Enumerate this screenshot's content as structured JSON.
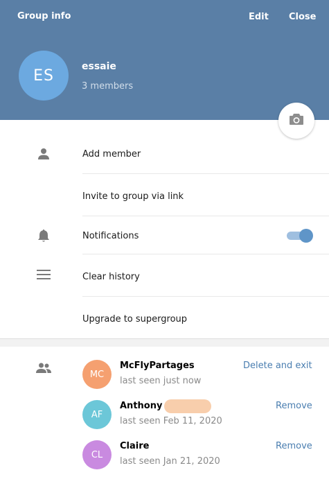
{
  "header": {
    "title": "Group info",
    "edit_label": "Edit",
    "close_label": "Close",
    "background": "#5a7fa6"
  },
  "group": {
    "initials": "ES",
    "name": "essaie",
    "members": "3 members",
    "avatar_color": "#6ca9e0"
  },
  "menu": {
    "add_member": "Add member",
    "invite_link": "Invite to group via link",
    "notifications": "Notifications",
    "notifications_enabled": true,
    "clear_history": "Clear history",
    "upgrade": "Upgrade to supergroup"
  },
  "members": [
    {
      "initials": "MC",
      "name": "McFlyPartages",
      "status": "last seen just now",
      "action": "Delete and exit",
      "color": "#f5a070"
    },
    {
      "initials": "AF",
      "name": "Anthony",
      "status": "last seen Feb 11, 2020",
      "action": "Remove",
      "color": "#6cc7d8"
    },
    {
      "initials": "CL",
      "name": "Claire",
      "status": "last seen Jan 21, 2020",
      "action": "Remove",
      "color": "#c98ae0"
    }
  ]
}
